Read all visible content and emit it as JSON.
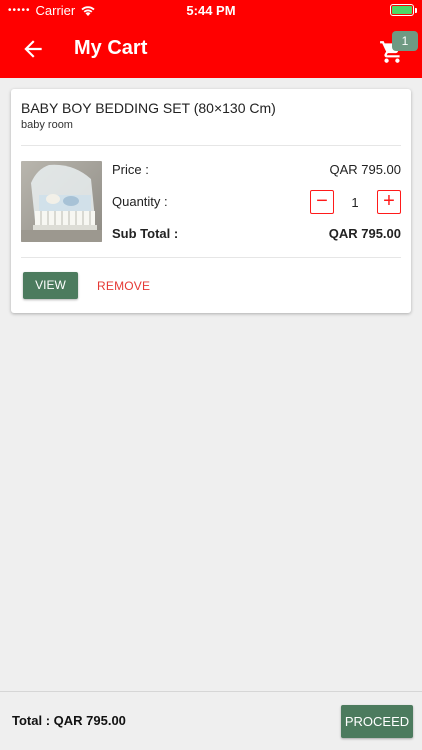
{
  "status_bar": {
    "signal_dots": "•••••",
    "carrier": "Carrier",
    "time": "5:44 PM",
    "battery_percent": 100
  },
  "header": {
    "title": "My Cart",
    "cart_badge_count": "1",
    "background_color": "#ff0000"
  },
  "cart_item": {
    "name": "BABY BOY BEDDING SET (80×130 Cm)",
    "category": "baby room",
    "price_label": "Price :",
    "price_value": "QAR 795.00",
    "quantity_label": "Quantity :",
    "quantity_value": "1",
    "decrement_symbol": "−",
    "increment_symbol": "+",
    "subtotal_label": "Sub Total :",
    "subtotal_value": "QAR 795.00",
    "view_label": "VIEW",
    "remove_label": "REMOVE"
  },
  "footer": {
    "total_text": "Total :  QAR 795.00",
    "proceed_label": "PROCEED",
    "button_color": "#4c7b5e"
  }
}
